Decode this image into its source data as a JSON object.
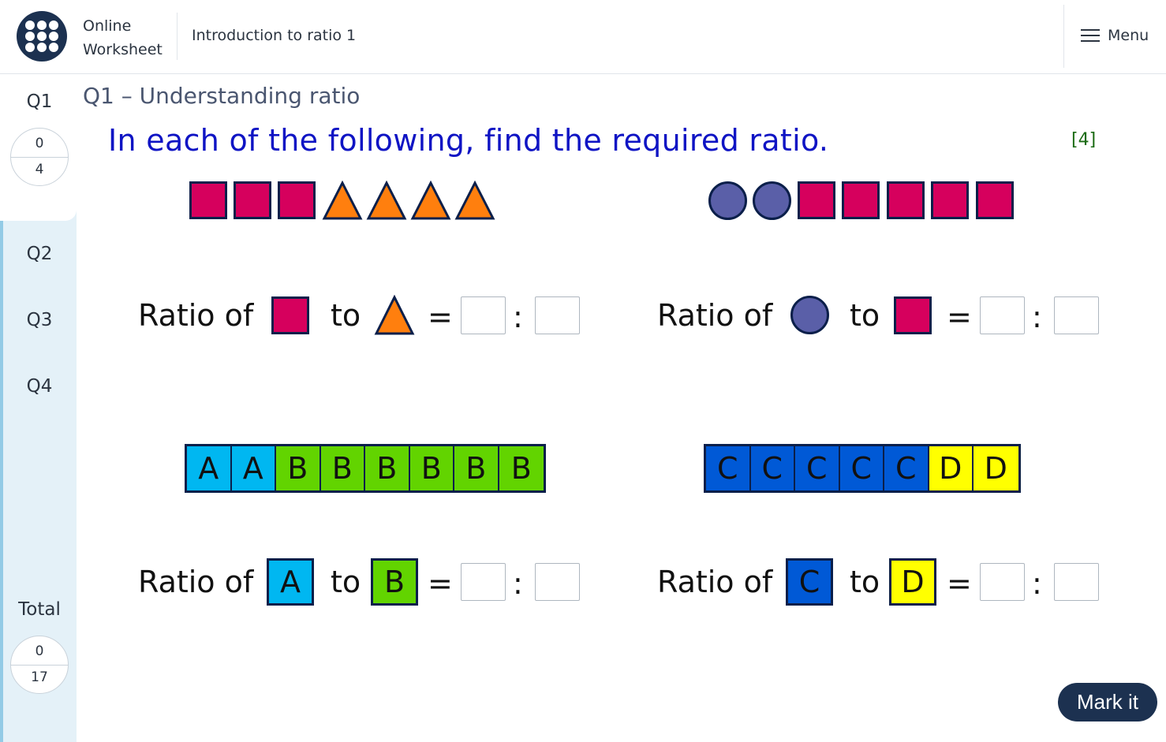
{
  "header": {
    "brand_line1": "Online",
    "brand_line2": "Worksheet",
    "title": "Introduction to ratio 1",
    "menu_label": "Menu"
  },
  "sidebar": {
    "q1": {
      "label": "Q1",
      "score": "0",
      "max": "4"
    },
    "q2": {
      "label": "Q2"
    },
    "q3": {
      "label": "Q3"
    },
    "q4": {
      "label": "Q4"
    },
    "total": {
      "label": "Total",
      "score": "0",
      "max": "17"
    }
  },
  "question": {
    "heading": "Q1 – Understanding ratio",
    "instruction": "In each of the following, find the required ratio.",
    "marks": "[4]"
  },
  "parts": {
    "a": {
      "prefix": "Ratio of",
      "to": "to",
      "equals": "=",
      "colon": ":",
      "first_shape": "square",
      "second_shape": "triangle"
    },
    "b": {
      "prefix": "Ratio of",
      "to": "to",
      "equals": "=",
      "colon": ":",
      "first_shape": "circle",
      "second_shape": "square"
    },
    "c": {
      "prefix": "Ratio of",
      "to": "to",
      "equals": "=",
      "colon": ":",
      "letters": [
        "A",
        "A",
        "B",
        "B",
        "B",
        "B",
        "B",
        "B"
      ],
      "first": "A",
      "second": "B"
    },
    "d": {
      "prefix": "Ratio of",
      "to": "to",
      "equals": "=",
      "colon": ":",
      "letters": [
        "C",
        "C",
        "C",
        "C",
        "C",
        "D",
        "D"
      ],
      "first": "C",
      "second": "D"
    }
  },
  "colors": {
    "square": "#d6005d",
    "triangle": "#ff7f0e",
    "circle": "#5a5fa8",
    "A": "#00b7f1",
    "B": "#62d400",
    "C": "#0059d6",
    "D": "#ffff00",
    "outline": "#0b1f4a"
  },
  "icons": {
    "logo": "dots-grid-icon",
    "menu": "hamburger-icon"
  },
  "mark_button": "Mark it"
}
